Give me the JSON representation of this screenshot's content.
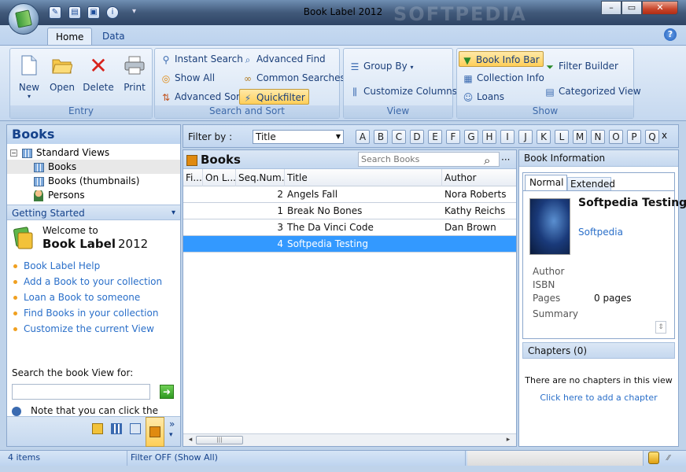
{
  "window": {
    "title": "Book Label 2012",
    "watermark": "SOFTPEDIA",
    "minimize": "–",
    "maximize": "▭",
    "close": "✕",
    "help": "?",
    "qat_more": "▾"
  },
  "tabs": [
    "Home",
    "Data"
  ],
  "ribbon": {
    "entry": {
      "title": "Entry",
      "buttons": [
        "New",
        "Open",
        "Delete",
        "Print"
      ],
      "new_dropdown": "▾"
    },
    "search": {
      "title": "Search and Sort",
      "instant": "Instant Search",
      "show_all": "Show All",
      "advanced_sort": "Advanced Sort",
      "advanced_find": "Advanced Find",
      "common": "Common Searches",
      "quickfilter": "Quickfilter"
    },
    "view": {
      "title": "View",
      "group_by": "Group By",
      "group_by_dropdown": "▾",
      "customize": "Customize Columns"
    },
    "show": {
      "title": "Show",
      "book_info_bar": "Book Info Bar",
      "collection_info": "Collection Info",
      "loans": "Loans",
      "filter_builder": "Filter Builder",
      "categorized": "Categorized View"
    }
  },
  "left": {
    "title": "Books",
    "tree_toggle": "−",
    "tree_root": "Standard Views",
    "tree_items": [
      "Books",
      "Books (thumbnails)",
      "Persons"
    ],
    "getting_started": "Getting Started",
    "gs_toggle": "▾",
    "welcome": "Welcome to",
    "app_name": "Book Label",
    "app_year": "2012",
    "links": [
      "Book Label Help",
      "Add a Book to your collection",
      "Loan a Book to someone",
      "Find Books in your collection",
      "Customize the current View"
    ],
    "search_label": "Search the book View for:",
    "search_value": "",
    "go": "➜",
    "note": "Note that you can click the",
    "nav_more": "»",
    "nav_more_down": "▾"
  },
  "filter": {
    "label": "Filter by :",
    "field": "Title",
    "letters": [
      "A",
      "B",
      "C",
      "D",
      "E",
      "F",
      "G",
      "H",
      "I",
      "J",
      "K",
      "L",
      "M",
      "N",
      "O",
      "P",
      "Q"
    ],
    "close": "x"
  },
  "grid": {
    "title": "Books",
    "search_placeholder": "Search Books",
    "search_button": "⌕",
    "more_button": "···",
    "columns": [
      "Fi...",
      "On L...",
      "Seq.Num...",
      "Title",
      "Author"
    ],
    "rows": [
      {
        "seq": "2",
        "title": "Angels Fall",
        "author": "Nora Roberts"
      },
      {
        "seq": "1",
        "title": "Break No Bones",
        "author": "Kathy Reichs"
      },
      {
        "seq": "3",
        "title": "The Da Vinci Code",
        "author": "Dan Brown"
      },
      {
        "seq": "4",
        "title": "Softpedia Testing",
        "author": ""
      }
    ],
    "hscroll_left": "◂",
    "hscroll_right": "▸",
    "hscroll_grip": "|||"
  },
  "info": {
    "header": "Book Information",
    "tabs": [
      "Normal",
      "Extended"
    ],
    "book_title": "Softpedia Testing",
    "publisher": "Softpedia",
    "fields": [
      {
        "label": "Author",
        "value": ""
      },
      {
        "label": "ISBN",
        "value": ""
      },
      {
        "label": "Pages",
        "value": "0 pages"
      },
      {
        "label": "Summary",
        "value": ""
      }
    ],
    "summary_scroll": "⇕",
    "chapters_header": "Chapters (0)",
    "no_chapters": "There are no chapters in this view",
    "add_chapter": "Click here to add a chapter"
  },
  "status": {
    "count": "4 items",
    "filter": "Filter OFF (Show All)",
    "resize_grip": "⁄⁄"
  }
}
